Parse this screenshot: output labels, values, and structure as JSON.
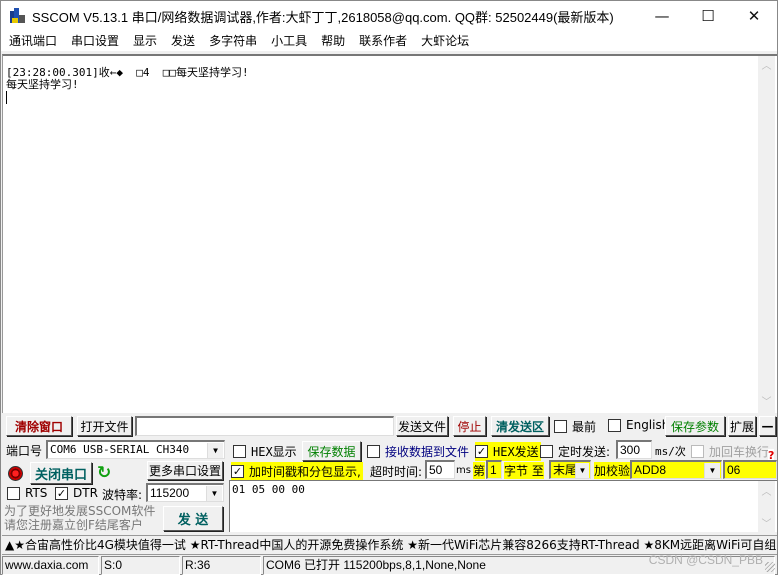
{
  "window": {
    "title": "SSCOM V5.13.1 串口/网络数据调试器,作者:大虾丁丁,2618058@qq.com. QQ群: 52502449(最新版本)",
    "controls": {
      "minimize": "—",
      "maximize": "☐",
      "close": "✕"
    }
  },
  "menu": [
    "通讯端口",
    "串口设置",
    "显示",
    "发送",
    "多字符串",
    "小工具",
    "帮助",
    "联系作者",
    "大虾论坛"
  ],
  "receive": {
    "lines": [
      "[23:28:00.301]收←◆  □4  □□每天坚持学习!",
      "每天坚持学习!"
    ]
  },
  "toolbar": {
    "clear_window": "清除窗口",
    "open_file": "打开文件",
    "file_path": "",
    "send_file": "发送文件",
    "stop": "停止",
    "clear_send": "清发送区",
    "topmost_label": "最前",
    "topmost_checked": false,
    "english_label": "English",
    "english_checked": false,
    "save_params": "保存参数",
    "expand": "扩展",
    "collapse": "—"
  },
  "port": {
    "port_label": "端口号",
    "port_value": "COM6 USB-SERIAL CH340",
    "close_port": "关闭串口",
    "more_settings": "更多串口设置",
    "rts_label": "RTS",
    "rts_checked": false,
    "dtr_label": "DTR",
    "dtr_checked": true,
    "baud_label": "波特率:",
    "baud_value": "115200",
    "promo_line1": "为了更好地发展SSCOM软件",
    "promo_line2": "请您注册嘉立创F结尾客户",
    "send": "发 送"
  },
  "options": {
    "hex_display_label": "HEX显示",
    "hex_display_checked": false,
    "save_data": "保存数据",
    "recv_to_file_label": "接收数据到文件",
    "recv_to_file_checked": false,
    "hex_send_label": "HEX发送",
    "hex_send_checked": true,
    "timed_send_label": "定时发送:",
    "timed_send_checked": false,
    "timed_interval": "300",
    "timed_unit": "ms/次",
    "add_crlf_label": "加回车换行",
    "add_crlf_checked": false,
    "timestamp_label": "加时间戳和分包显示,",
    "timestamp_checked": true,
    "timeout_label": "超时时间:",
    "timeout_value": "50",
    "timeout_unit": "ms",
    "byte_from_label": "第",
    "byte_from_value": "1",
    "byte_unit_to": "字节 至",
    "byte_to_value": "末尾",
    "checksum_label": "加校验",
    "checksum_value": "ADD8",
    "checksum_result": "06",
    "help": "?"
  },
  "send_area": {
    "content": "01 05 00 00"
  },
  "ticker": {
    "text": "▲★合宙高性价比4G模块值得一试 ★RT-Thread中国人的开源免费操作系统 ★新一代WiFi芯片兼容8266支持RT-Thread ★8KM远距离WiFi可自组网"
  },
  "statusbar": {
    "website": "www.daxia.com",
    "sent": "S:0",
    "received": "R:36",
    "port_status": "COM6 已打开  115200bps,8,1,None,None"
  },
  "watermark": "CSDN @CSDN_PBB"
}
